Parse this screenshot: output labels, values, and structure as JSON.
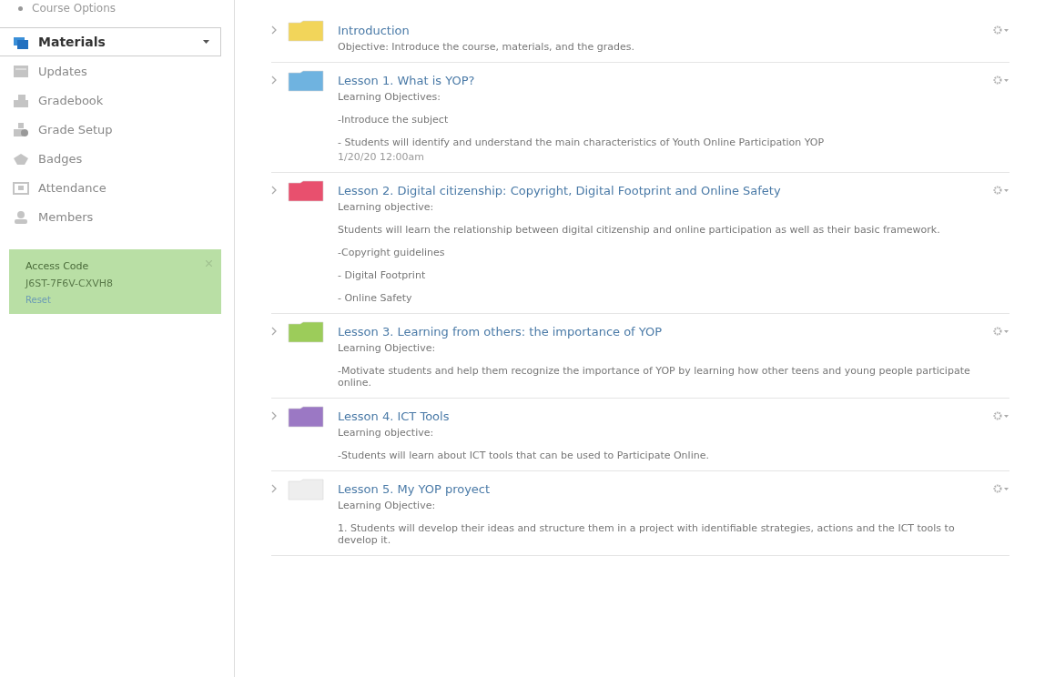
{
  "sidebar": {
    "top_item": "Course Options",
    "items": [
      {
        "label": "Materials",
        "selected": true
      },
      {
        "label": "Updates",
        "selected": false
      },
      {
        "label": "Gradebook",
        "selected": false
      },
      {
        "label": "Grade Setup",
        "selected": false
      },
      {
        "label": "Badges",
        "selected": false
      },
      {
        "label": "Attendance",
        "selected": false
      },
      {
        "label": "Members",
        "selected": false
      }
    ],
    "access_code": {
      "title": "Access Code",
      "code": "J6ST-7F6V-CXVH8",
      "reset": "Reset"
    }
  },
  "materials": [
    {
      "title": "Introduction",
      "color": "#f2d55a",
      "lines": [
        "Objective: Introduce the course, materials, and the grades."
      ]
    },
    {
      "title": "Lesson 1. What is YOP?",
      "color": "#6fb3e0",
      "lines": [
        "Learning Objectives:",
        "-Introduce the subject",
        "- Students will identify and understand the main characteristics of Youth Online Participation YOP"
      ],
      "date": "1/20/20 12:00am"
    },
    {
      "title": "Lesson 2. Digital citizenship: Copyright, Digital Footprint and Online Safety",
      "color": "#e8506e",
      "lines": [
        "Learning objective:",
        "Students will learn the relationship between digital citizenship and online participation as well as their basic framework.",
        "-Copyright guidelines",
        "- Digital Footprint",
        "- Online Safety"
      ]
    },
    {
      "title": "Lesson 3. Learning from others: the importance of YOP",
      "color": "#9ccc5a",
      "lines": [
        "Learning Objective:",
        "-Motivate students and help them recognize the importance of YOP by learning how other teens and young people participate online."
      ]
    },
    {
      "title": "Lesson 4. ICT Tools",
      "color": "#9b78c4",
      "lines": [
        "Learning objective:",
        "-Students will learn about ICT tools that can be used to Participate Online."
      ]
    },
    {
      "title": "Lesson 5. My YOP proyect",
      "color": "#eeeeee",
      "lines": [
        "Learning Objective:",
        "1. Students will develop their ideas and structure them in a project with identifiable strategies, actions and the ICT tools to develop it."
      ]
    }
  ]
}
